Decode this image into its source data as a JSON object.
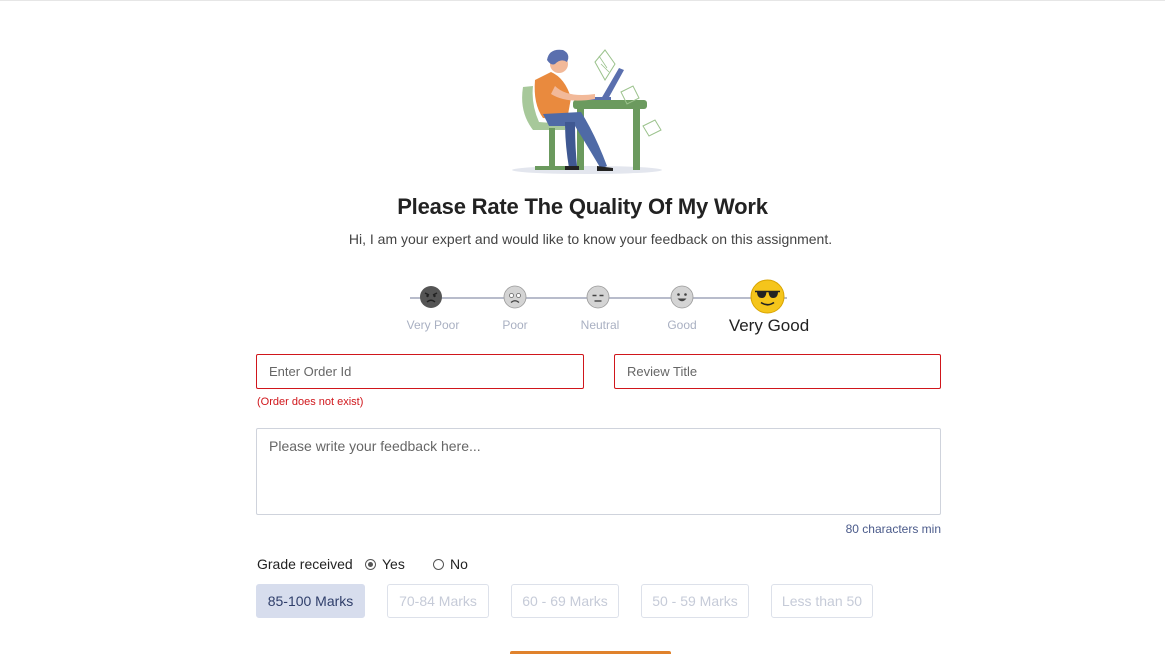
{
  "header": {
    "title": "Please Rate The Quality Of My Work",
    "subtitle": "Hi, I am your expert and would like to know your feedback on this assignment."
  },
  "rating": {
    "options": [
      "Very Poor",
      "Poor",
      "Neutral",
      "Good",
      "Very Good"
    ],
    "selected": "Very Good",
    "icons": [
      "angry-face-icon",
      "sad-face-icon",
      "neutral-face-icon",
      "smile-face-icon",
      "sunglasses-face-icon"
    ]
  },
  "form": {
    "order_id_placeholder": "Enter Order Id",
    "order_error": "(Order does not exist)",
    "review_title_placeholder": "Review Title",
    "feedback_placeholder": "Please write your feedback here...",
    "char_hint": "80 characters min"
  },
  "grade": {
    "label": "Grade received",
    "yes": "Yes",
    "no": "No",
    "selected": "Yes",
    "marks": [
      "85-100 Marks",
      "70-84 Marks",
      "60 - 69 Marks",
      "50 - 59 Marks",
      "Less than 50"
    ],
    "selected_mark": "85-100 Marks"
  },
  "colors": {
    "error": "#d0161b",
    "accent": "#e0822c",
    "selected_chip": "#d7dded",
    "face_yellow": "#f5c51b"
  }
}
